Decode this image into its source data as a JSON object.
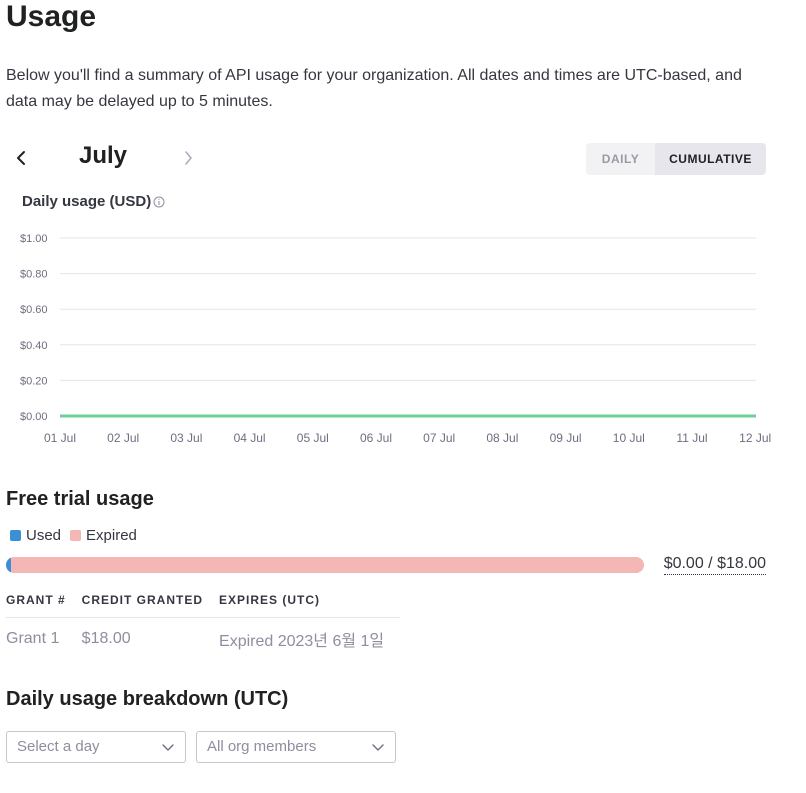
{
  "page": {
    "title": "Usage",
    "intro": "Below you'll find a summary of API usage for your organization. All dates and times are UTC-based, and data may be delayed up to 5 minutes."
  },
  "month_nav": {
    "month": "July",
    "prev_icon": "chevron-left-icon",
    "next_icon": "chevron-right-icon"
  },
  "view_toggle": {
    "daily": "DAILY",
    "cumulative": "CUMULATIVE",
    "selected": "CUMULATIVE"
  },
  "chart": {
    "title": "Daily usage (USD)",
    "info_icon": "info-icon"
  },
  "chart_data": {
    "type": "line",
    "title": "Daily usage (USD)",
    "x": [
      "01 Jul",
      "02 Jul",
      "03 Jul",
      "04 Jul",
      "05 Jul",
      "06 Jul",
      "07 Jul",
      "08 Jul",
      "09 Jul",
      "10 Jul",
      "11 Jul",
      "12 Jul"
    ],
    "series": [
      {
        "values": [
          0,
          0,
          0,
          0,
          0,
          0,
          0,
          0,
          0,
          0,
          0,
          0
        ],
        "color": "#6fcf97"
      }
    ],
    "y_ticks": [
      "$0.00",
      "$0.20",
      "$0.40",
      "$0.60",
      "$0.80",
      "$1.00"
    ],
    "y_tick_values": [
      0,
      0.2,
      0.4,
      0.6,
      0.8,
      1.0
    ],
    "ylim": [
      0,
      1.0
    ],
    "grid": true
  },
  "free_trial": {
    "title": "Free trial usage",
    "legend": [
      {
        "label": "Used",
        "color": "#3b8fd4"
      },
      {
        "label": "Expired",
        "color": "#f5b6b6"
      }
    ],
    "used_fraction": 0.008,
    "total_label": "$0.00 / $18.00",
    "table": {
      "headers": [
        "GRANT #",
        "CREDIT GRANTED",
        "EXPIRES (UTC)"
      ],
      "rows": [
        [
          "Grant 1",
          "$18.00",
          "Expired 2023년 6월 1일"
        ]
      ]
    }
  },
  "breakdown": {
    "title": "Daily usage breakdown (UTC)",
    "day_select_placeholder": "Select a day",
    "members_select_value": "All org members"
  }
}
